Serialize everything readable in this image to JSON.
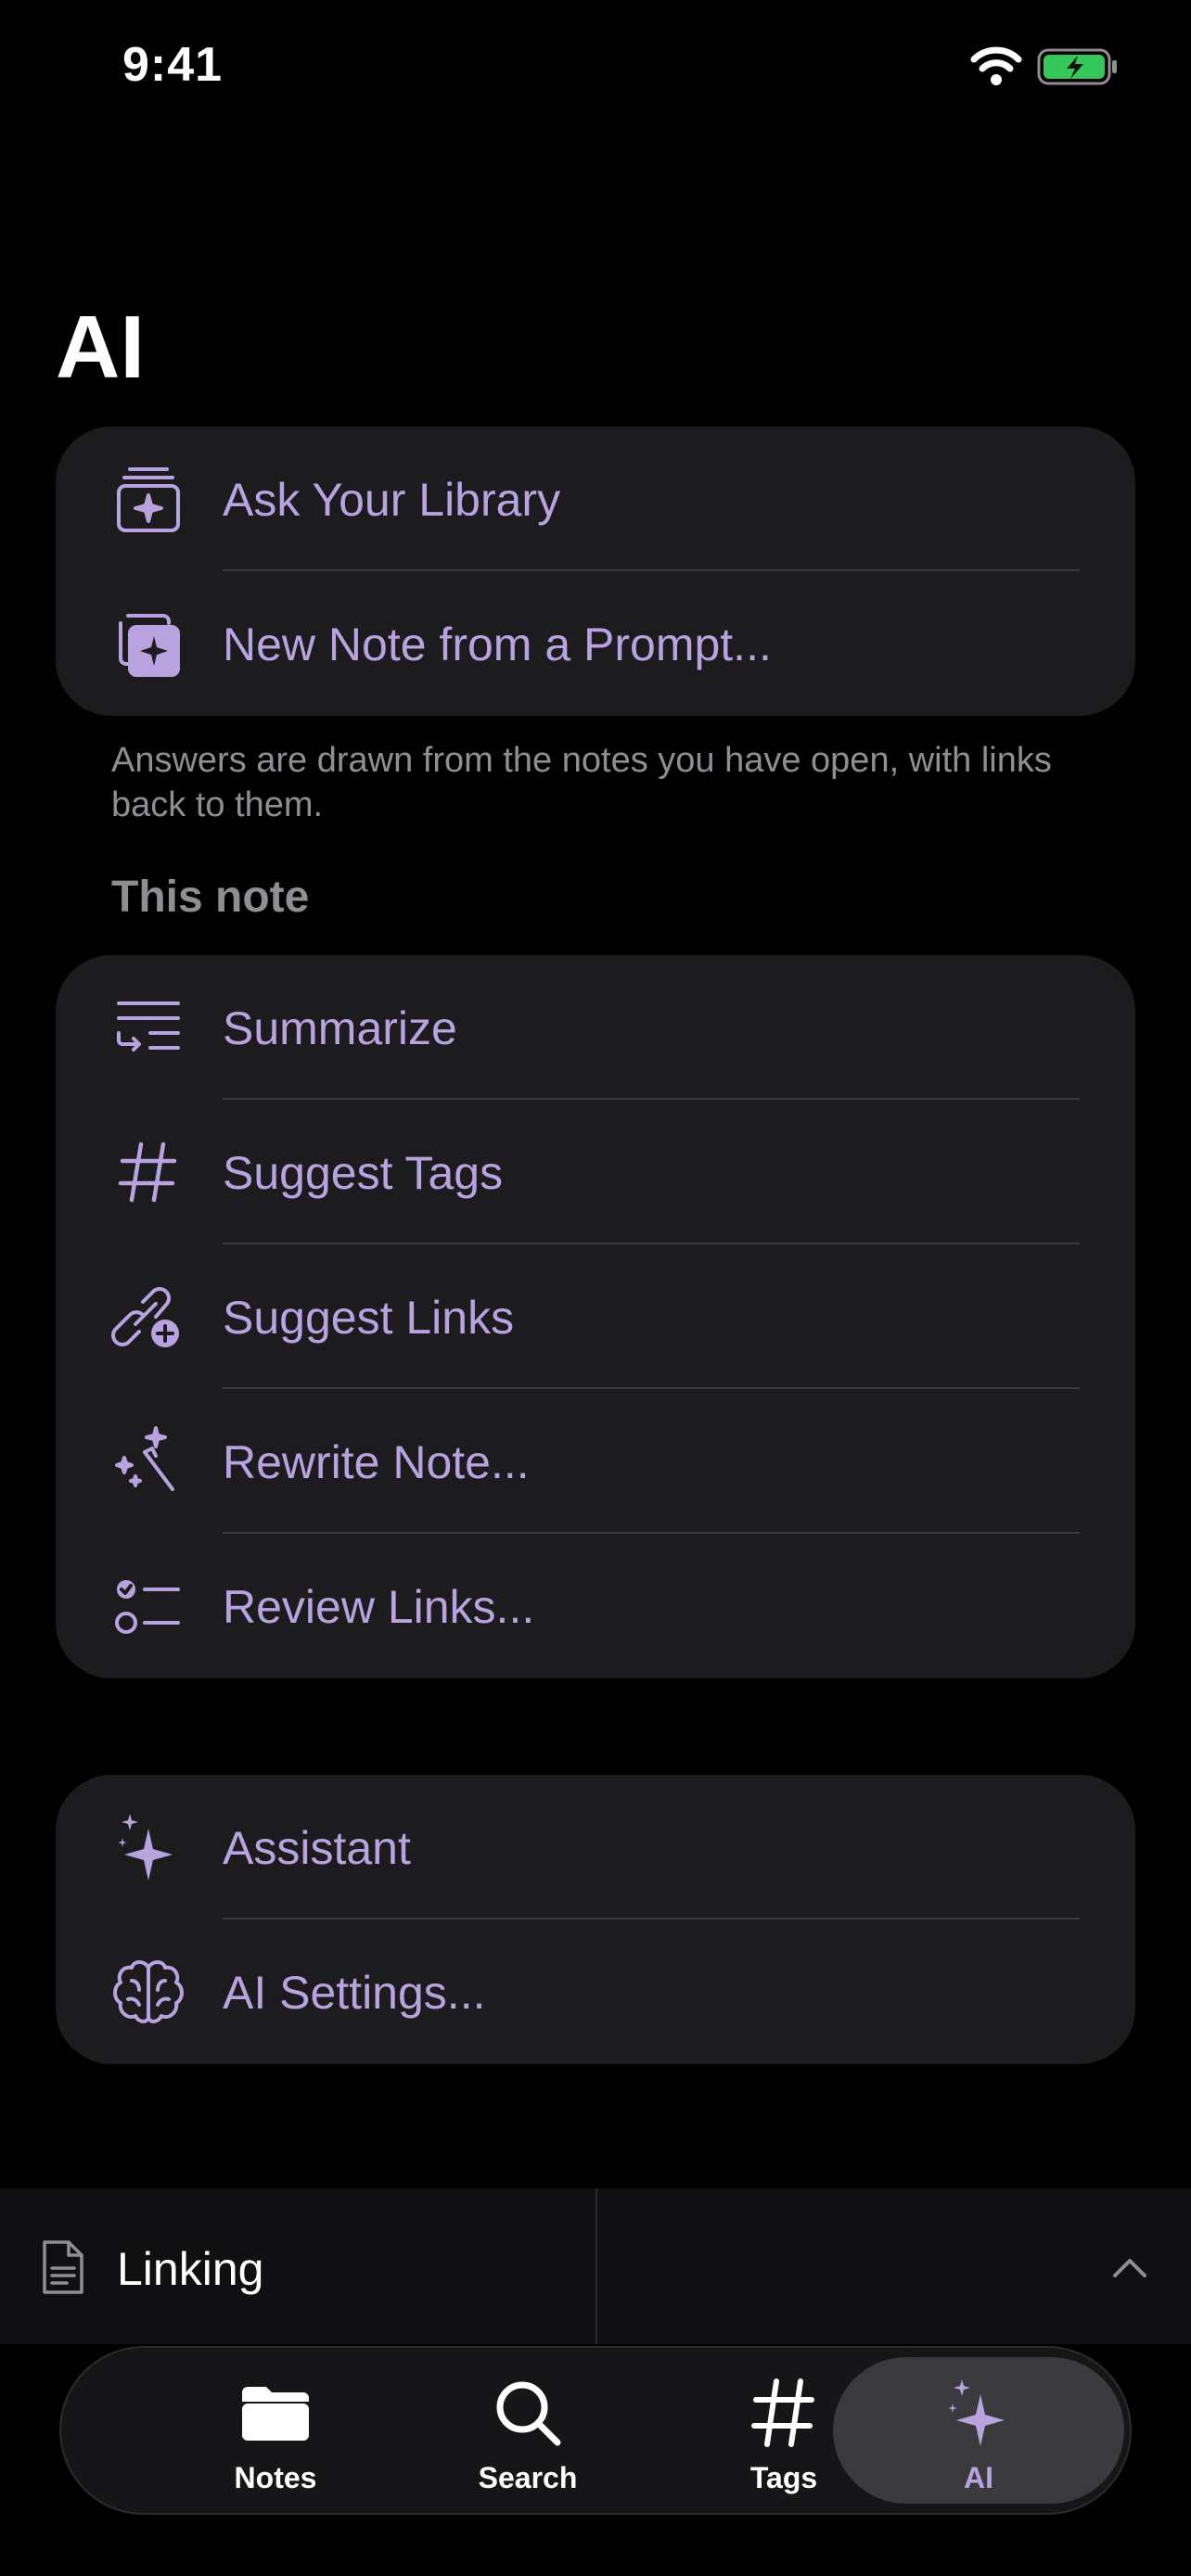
{
  "status_bar": {
    "time": "9:41"
  },
  "page": {
    "title": "AI"
  },
  "library_card": {
    "items": [
      {
        "label": "Ask Your Library",
        "icon": "library-sparkle-icon"
      },
      {
        "label": "New Note from a Prompt...",
        "icon": "new-note-sparkle-icon"
      }
    ],
    "footnote": "Answers are drawn from the notes you have open, with links back to them."
  },
  "this_note": {
    "header": "This note",
    "items": [
      {
        "label": "Summarize",
        "icon": "summarize-icon"
      },
      {
        "label": "Suggest Tags",
        "icon": "hashtag-icon"
      },
      {
        "label": "Suggest Links",
        "icon": "link-plus-icon"
      },
      {
        "label": "Rewrite Note...",
        "icon": "magic-wand-icon"
      },
      {
        "label": "Review Links...",
        "icon": "checklist-icon"
      }
    ]
  },
  "assistant_card": {
    "items": [
      {
        "label": "Assistant",
        "icon": "sparkles-icon"
      },
      {
        "label": "AI Settings...",
        "icon": "brain-icon"
      }
    ]
  },
  "linking_bar": {
    "label": "Linking"
  },
  "tab_bar": {
    "tabs": [
      {
        "label": "Notes",
        "icon": "folder-icon",
        "active": false
      },
      {
        "label": "Search",
        "icon": "magnifier-icon",
        "active": false
      },
      {
        "label": "Tags",
        "icon": "hashtag-icon",
        "active": false
      },
      {
        "label": "AI",
        "icon": "sparkles-icon",
        "active": true
      }
    ]
  },
  "colors": {
    "accent": "#b8a2e0",
    "card_background": "#1c1c1e",
    "background": "#000000",
    "battery": "#34c759"
  }
}
